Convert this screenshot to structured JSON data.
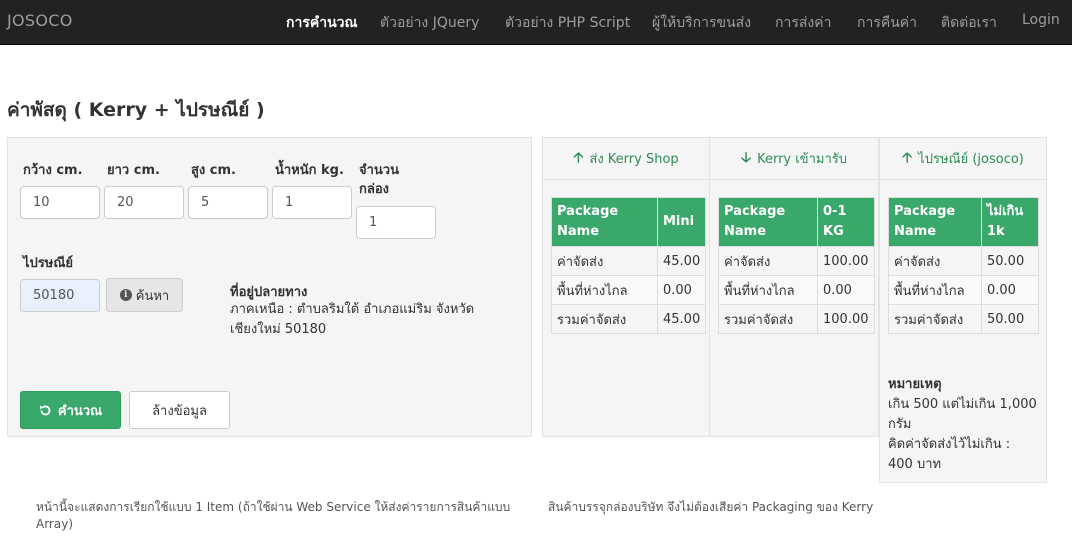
{
  "navbar": {
    "brand": "JOSOCO",
    "items": [
      {
        "label": "การคำนวณ",
        "active": true
      },
      {
        "label": "ตัวอย่าง JQuery"
      },
      {
        "label": "ตัวอย่าง PHP Script"
      },
      {
        "label": "ผู้ให้บริการขนส่ง"
      },
      {
        "label": "การส่งค่า"
      },
      {
        "label": "การคืนค่า"
      },
      {
        "label": "ติดต่อเรา"
      },
      {
        "label": "Login"
      }
    ]
  },
  "page_title": "ค่าพัสดุ ( Kerry + ไปรษณีย์ )",
  "form": {
    "width_label": "กว้าง cm.",
    "width_value": "10",
    "length_label": "ยาว cm.",
    "length_value": "20",
    "height_label": "สูง cm.",
    "height_value": "5",
    "weight_label": "น้ำหนัก kg.",
    "weight_value": "1",
    "count_label_1": "จำนวน",
    "count_label_2": "กล่อง",
    "count_value": "1",
    "postcode_label": "ไปรษณีย์",
    "postcode_value": "50180",
    "search_label": "ค้นหา",
    "address_title": "ที่อยู่ปลายทาง",
    "address_text": "ภาคเหนือ : ตำบลริมใต้ อำเภอแม่ริม จังหวัดเชียงใหม่ 50180",
    "calc_label": "คำนวณ",
    "clear_label": "ล้างข้อมูล"
  },
  "columns": [
    {
      "header": "ส่ง Kerry Shop",
      "direction": "up",
      "col_name": "Package Name",
      "col_value": "Mini",
      "rows": [
        {
          "label": "ค่าจัดส่ง",
          "value": "45.00"
        },
        {
          "label": "พื้นที่ห่างไกล",
          "value": "0.00"
        },
        {
          "label": "รวมค่าจัดส่ง",
          "value": "45.00"
        }
      ]
    },
    {
      "header": "Kerry เข้ามารับ",
      "direction": "down",
      "col_name": "Package Name",
      "col_value": "0-1 KG",
      "rows": [
        {
          "label": "ค่าจัดส่ง",
          "value": "100.00"
        },
        {
          "label": "พื้นที่ห่างไกล",
          "value": "0.00"
        },
        {
          "label": "รวมค่าจัดส่ง",
          "value": "100.00"
        }
      ]
    },
    {
      "header": "ไปรษณีย์ (josoco)",
      "direction": "up",
      "col_name": "Package Name",
      "col_value": "ไม่เกิน 1k",
      "rows": [
        {
          "label": "ค่าจัดส่ง",
          "value": "50.00"
        },
        {
          "label": "พื้นที่ห่างไกล",
          "value": "0.00"
        },
        {
          "label": "รวมค่าจัดส่ง",
          "value": "50.00"
        }
      ]
    }
  ],
  "note": {
    "title": "หมายเหตุ",
    "line1": "เกิน 500 แต่ไม่เกิน 1,000 กรัม",
    "line2": "คิดค่าจัดส่งไว้ไม่เกิน : 400 บาท"
  },
  "footer": {
    "left": "หน้านี้จะแสดงการเรียกใช้แบบ 1 Item (ถ้าใช้ผ่าน Web Service ให้ส่งค่ารายการสินค้าแบบ Array)",
    "right": "สินค้าบรรจุกล่องบริษัท จึงไม่ต้องเสียค่า Packaging ของ Kerry"
  },
  "colors": {
    "accent": "#3aa86a",
    "link_green": "#2e8b57",
    "navbar_bg": "#222222"
  }
}
